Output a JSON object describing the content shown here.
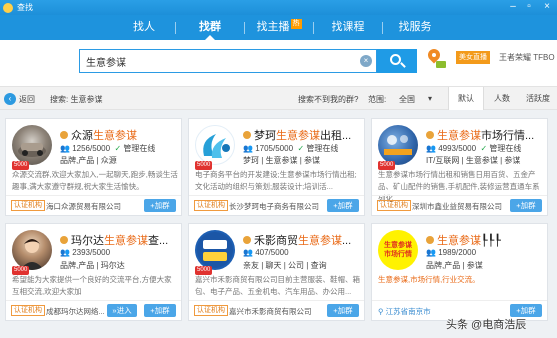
{
  "window": {
    "title": "查找"
  },
  "nav": {
    "tabs": [
      {
        "label": "找人",
        "active": false
      },
      {
        "label": "找群",
        "active": true
      },
      {
        "label": "找主播",
        "active": false,
        "badge": "热"
      },
      {
        "label": "找课程",
        "active": false
      },
      {
        "label": "找服务",
        "active": false
      }
    ]
  },
  "search": {
    "value": "生意参谋",
    "clear_icon": "×",
    "live_badge": "美女直播",
    "ad_text": "王者荣耀  TFBO"
  },
  "filters": {
    "back_label": "返回",
    "search_label": "搜索: 生意参谋",
    "not_found": "搜索不到我的群?",
    "range_label": "范围:",
    "range_value": "全国",
    "sort_tabs": [
      "默认",
      "人数",
      "活跃度"
    ],
    "active_sort": "默认"
  },
  "cards": [
    {
      "name_prefix": "众源",
      "name_hl": "生意参谋",
      "name_suffix": "",
      "members": "1256/5000",
      "managed": "管理在线",
      "tags": "品牌,产品 | 众源",
      "desc": "众源交流群,欢迎大家加入,一起聊天,跑步,畅谈生活趣事,满大家遵守群规,祝大家生活愉快。",
      "level": "5000",
      "cert": "认证机构",
      "company": "海口众源贸易有限公司",
      "join": "+加群"
    },
    {
      "name_prefix": "梦珂",
      "name_hl": "生意参谋",
      "name_suffix": "出租...",
      "members": "1705/5000",
      "managed": "管理在线",
      "tags": "梦珂 | 生意参谋 | 参谋",
      "desc": "电子商务平台的开发建设;生意参谋市场行情出租;文化活动的组织与策划;服装设计;培训活...",
      "level": "5000",
      "cert": "认证机构",
      "company": "长沙梦珂电子商务有限公司",
      "join": "+加群"
    },
    {
      "name_prefix": "",
      "name_hl": "生意参谋",
      "name_suffix": "市场行情...",
      "members": "4993/5000",
      "managed": "管理在线",
      "tags": "IT/互联网 | 生意参谋 | 参谋",
      "desc": "生意参谋市场行情出租和销售日用百货、五金产品、矿山配件的销售,手机配件,装修运营直通车系列化...",
      "level": "5000",
      "cert": "认证机构",
      "company": "深圳市鑫业益贸易有限公司",
      "join": "+加群"
    },
    {
      "name_prefix": "玛尔达",
      "name_hl": "生意参谋",
      "name_suffix": "查...",
      "members": "2393/5000",
      "tags": "品牌,产品 | 玛尔达",
      "desc": "希望能为大家提供一个良好的交流平台,方便大家互相交流,欢迎大家加",
      "level": "5000",
      "cert": "认证机构",
      "company": "成都玛尔达网络...",
      "join": "+加群",
      "join2": "»进入"
    },
    {
      "name_prefix": "禾影商贸",
      "name_hl": "生意参谋",
      "name_suffix": "...",
      "members": "407/5000",
      "tags": "亲友 | 聊天 | 公司 | 查询",
      "desc": "嘉兴市禾影商贸有限公司目前主营服装、鞋帽、箱包、电子产品、五金机电、汽车用品、办公用...",
      "level": "5000",
      "cert": "认证机构",
      "company": "嘉兴市禾影商贸有限公司",
      "join": "+加群"
    },
    {
      "name_prefix": "",
      "name_hl": "生意参谋",
      "name_suffix": "┞┞┞",
      "members": "1989/2000",
      "tags": "品牌,产品 | 参谋",
      "desc": "生意参谋,市场行情,行业交流。",
      "avatar_text": "生意参谋\n市场行情",
      "location": "江苏省南京市",
      "join": "+加群"
    }
  ],
  "watermark": "头条 @电商浩辰",
  "colors": {
    "brand_blue": "#1e93dd",
    "highlight_orange": "#e96a17",
    "cert_orange": "#f09a3e"
  }
}
